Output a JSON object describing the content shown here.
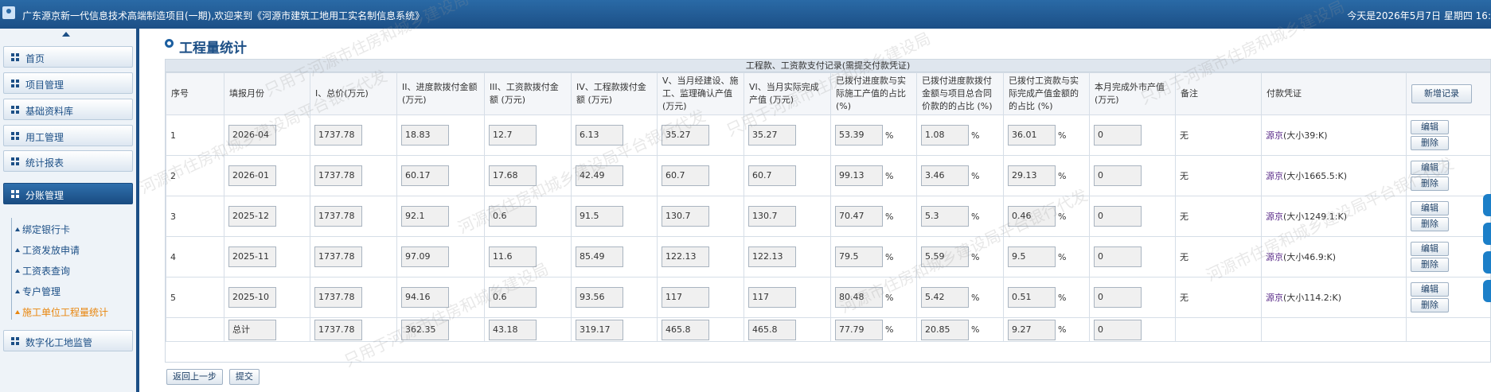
{
  "topbar": {
    "title": "广东源京新一代信息技术高端制造项目(一期),欢迎来到《河源市建筑工地用工实名制信息系统》",
    "date": "今天是2026年5月7日 星期四 16:"
  },
  "sidebar": {
    "items": [
      {
        "label": "首页"
      },
      {
        "label": "项目管理"
      },
      {
        "label": "基础资料库"
      },
      {
        "label": "用工管理"
      },
      {
        "label": "统计报表"
      },
      {
        "label": "分账管理"
      },
      {
        "label": "数字化工地监管"
      }
    ],
    "subitems": [
      {
        "label": "绑定银行卡"
      },
      {
        "label": "工资发放申请"
      },
      {
        "label": "工资表查询"
      },
      {
        "label": "专户管理"
      },
      {
        "label": "施工单位工程量统计"
      }
    ]
  },
  "page": {
    "title": "工程量统计",
    "caption": "工程款、工资款支付记录(需提交付款凭证)",
    "new_button": "新增记录",
    "back_button": "返回上一步",
    "submit_button": "提交",
    "edit_label": "编辑",
    "delete_label": "删除",
    "percent": "%"
  },
  "table": {
    "headers": [
      "序号",
      "填报月份",
      "I、总价(万元)",
      "II、进度款拨付金额 (万元)",
      "III、工资款拨付金额 (万元)",
      "IV、工程款拨付金额 (万元)",
      "V、当月经建设、施工、监理确认产值(万元)",
      "VI、当月实际完成产值 (万元)",
      "已拨付进度款与实际施工产值的占比(%)",
      "已拨付进度款拨付金额与项目总合同价款的的占比 (%)",
      "已拨付工资款与实际完成产值金额的的占比 (%)",
      "本月完成外市产值(万元)",
      "备注",
      "付款凭证"
    ],
    "rows": [
      {
        "no": "1",
        "month": "2026-04",
        "total": "1737.78",
        "progress": "18.83",
        "wage": "12.7",
        "eng": "6.13",
        "confirmed": "35.27",
        "actual": "35.27",
        "r1": "53.39",
        "r2": "1.08",
        "r3": "36.01",
        "outside": "0",
        "remark": "无",
        "voucher": "源京",
        "size": "(大小39:K)"
      },
      {
        "no": "2",
        "month": "2026-01",
        "total": "1737.78",
        "progress": "60.17",
        "wage": "17.68",
        "eng": "42.49",
        "confirmed": "60.7",
        "actual": "60.7",
        "r1": "99.13",
        "r2": "3.46",
        "r3": "29.13",
        "outside": "0",
        "remark": "无",
        "voucher": "源京",
        "size": "(大小1665.5:K)"
      },
      {
        "no": "3",
        "month": "2025-12",
        "total": "1737.78",
        "progress": "92.1",
        "wage": "0.6",
        "eng": "91.5",
        "confirmed": "130.7",
        "actual": "130.7",
        "r1": "70.47",
        "r2": "5.3",
        "r3": "0.46",
        "outside": "0",
        "remark": "无",
        "voucher": "源京",
        "size": "(大小1249.1:K)"
      },
      {
        "no": "4",
        "month": "2025-11",
        "total": "1737.78",
        "progress": "97.09",
        "wage": "11.6",
        "eng": "85.49",
        "confirmed": "122.13",
        "actual": "122.13",
        "r1": "79.5",
        "r2": "5.59",
        "r3": "9.5",
        "outside": "0",
        "remark": "无",
        "voucher": "源京",
        "size": "(大小46.9:K)"
      },
      {
        "no": "5",
        "month": "2025-10",
        "total": "1737.78",
        "progress": "94.16",
        "wage": "0.6",
        "eng": "93.56",
        "confirmed": "117",
        "actual": "117",
        "r1": "80.48",
        "r2": "5.42",
        "r3": "0.51",
        "outside": "0",
        "remark": "无",
        "voucher": "源京",
        "size": "(大小114.2:K)"
      }
    ],
    "total": {
      "label": "总计",
      "total": "1737.78",
      "progress": "362.35",
      "wage": "43.18",
      "eng": "319.17",
      "confirmed": "465.8",
      "actual": "465.8",
      "r1": "77.79",
      "r2": "20.85",
      "r3": "9.27",
      "outside": "0"
    }
  },
  "watermark": {
    "line1": "只用于河源市住房和城乡建设局",
    "line2": "河源市住房和城乡建设局平台银行代发"
  },
  "colors": {
    "primary": "#1c4f86",
    "accent": "#e8860e",
    "link": "#5b2d8a"
  }
}
